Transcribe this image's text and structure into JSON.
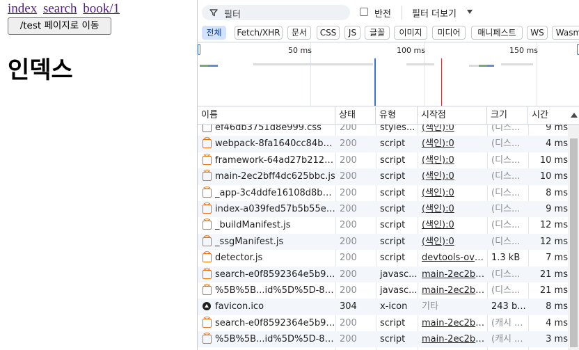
{
  "page": {
    "nav": [
      {
        "label": "index"
      },
      {
        "label": "search"
      },
      {
        "label": "book/1"
      }
    ],
    "go_button_label": "/test 페이지로 이동",
    "heading": "인덱스"
  },
  "devtools": {
    "filter": {
      "placeholder": "필터",
      "invert_label": "반전",
      "more_filters_label": "필터 더보기"
    },
    "types": [
      {
        "label": "전체",
        "active": true
      },
      {
        "label": "Fetch/XHR"
      },
      {
        "label": "문서"
      },
      {
        "label": "CSS"
      },
      {
        "label": "JS"
      },
      {
        "label": "글꼴"
      },
      {
        "label": "이미지"
      },
      {
        "label": "미디어"
      },
      {
        "label": "매니페스트"
      },
      {
        "label": "WS"
      },
      {
        "label": "Wasm"
      }
    ],
    "overview": {
      "ticks": [
        "50 ms",
        "100 ms",
        "150 ms"
      ]
    },
    "columns": {
      "name": "이름",
      "status": "상태",
      "type": "유형",
      "initiator": "시작점",
      "size": "크기",
      "time": "시간"
    },
    "rows": [
      {
        "icon": "css-file-icon",
        "name": "ef46db3751d8e999.css",
        "status": "200",
        "type": "styles...",
        "initiator": "(색인):0",
        "size": "(디스...",
        "time": "9 ms"
      },
      {
        "icon": "script-file-icon",
        "name": "webpack-8fa1640cc84ba8...",
        "status": "200",
        "type": "script",
        "initiator": "(색인):0",
        "size": "(디스...",
        "time": "4 ms"
      },
      {
        "icon": "script-file-icon",
        "name": "framework-64ad27b2126...",
        "status": "200",
        "type": "script",
        "initiator": "(색인):0",
        "size": "(디스...",
        "time": "10 ms"
      },
      {
        "icon": "script-file-icon",
        "name": "main-2ec2bff4dc625bbc.js",
        "status": "200",
        "type": "script",
        "initiator": "(색인):0",
        "size": "(디스...",
        "time": "10 ms"
      },
      {
        "icon": "script-file-icon",
        "name": "_app-3c4ddfe16108d8b8.js",
        "status": "200",
        "type": "script",
        "initiator": "(색인):0",
        "size": "(디스...",
        "time": "8 ms"
      },
      {
        "icon": "script-file-icon",
        "name": "index-a039fed57b5b55e7.js",
        "status": "200",
        "type": "script",
        "initiator": "(색인):0",
        "size": "(디스...",
        "time": "9 ms"
      },
      {
        "icon": "script-file-icon",
        "name": "_buildManifest.js",
        "status": "200",
        "type": "script",
        "initiator": "(색인):0",
        "size": "(디스...",
        "time": "12 ms"
      },
      {
        "icon": "script-file-icon",
        "name": "_ssgManifest.js",
        "status": "200",
        "type": "script",
        "initiator": "(색인):0",
        "size": "(디스...",
        "time": "12 ms"
      },
      {
        "icon": "script-file-icon",
        "name": "detector.js",
        "status": "200",
        "type": "script",
        "initiator": "devtools-overla",
        "size": "1.3 kB",
        "time": "7 ms"
      },
      {
        "icon": "script-file-icon",
        "name": "search-e0f8592364e5b92...",
        "status": "200",
        "type": "javasc...",
        "initiator": "main-2ec2bff4c",
        "size": "(디스...",
        "time": "21 ms"
      },
      {
        "icon": "script-file-icon",
        "name": "%5B%5B...id%5D%5D-89...",
        "status": "200",
        "type": "javasc...",
        "initiator": "main-2ec2bff4c",
        "size": "(디스...",
        "time": "21 ms"
      },
      {
        "icon": "favicon-file-icon",
        "name": "favicon.ico",
        "status": "304",
        "type": "x-icon",
        "initiator": "기타",
        "size": "243 b...",
        "time": "8 ms"
      },
      {
        "icon": "script-file-icon",
        "name": "search-e0f8592364e5b92...",
        "status": "200",
        "type": "script",
        "initiator": "main-2ec2bff4c",
        "size": "(캐시 ...",
        "time": "4 ms"
      },
      {
        "icon": "script-file-icon",
        "name": "%5B%5B...id%5D%5D-89...",
        "status": "200",
        "type": "script",
        "initiator": "main-2ec2bff4c",
        "size": "(캐시 ...",
        "time": "3 ms"
      }
    ]
  }
}
